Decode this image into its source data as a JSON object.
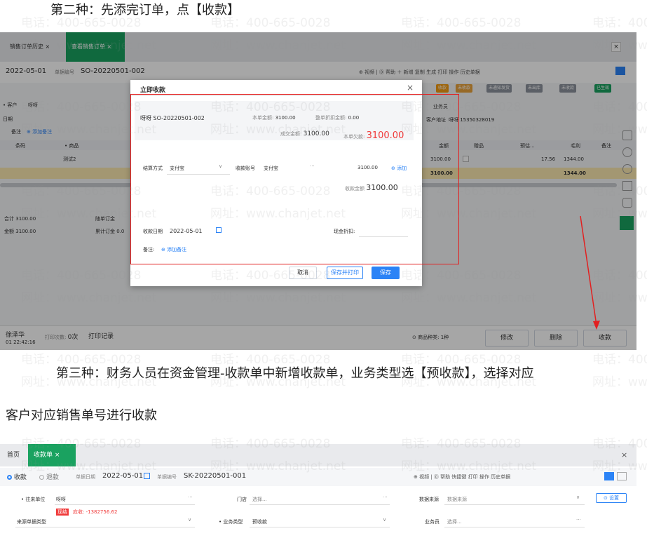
{
  "headings": {
    "h2": "第二种：先添完订单，点【收款】",
    "h3a": "第三种：财务人员在资金管理-收款单中新增收款单，业务类型选【预收款】，选择对应",
    "h3b": "客户对应销售单号进行收款"
  },
  "watermark": {
    "phone": "电话：400-665-0028",
    "site": "网址：www.chanjet.net"
  },
  "shot1": {
    "tabs": {
      "history": "销售订单历史 ×",
      "view": "查看销售订单 ×"
    },
    "date": "2022-05-01",
    "doc_no_label": "单据编号",
    "doc_no": "SO-20220501-002",
    "toolbar": [
      "⊕ 视频",
      "⓪ 帮助",
      "＋ 新增",
      "复制",
      "生成",
      "打印",
      "操作",
      "历史单据"
    ],
    "customer_label": "• 客户",
    "customer": "呀呀",
    "date2_label": "日期",
    "remark_label": "备注",
    "add_remark": "添加备注",
    "col_barcode": "条码",
    "col_product": "• 商品",
    "product": "测试2",
    "right_cols": [
      "金额",
      "赠品",
      "预估...",
      "毛利",
      "备注"
    ],
    "right_row": [
      "3100.00",
      "",
      "17.56",
      "1344.00"
    ],
    "total_row": [
      "3100.00",
      "1344.00"
    ],
    "status_pills": [
      "收款",
      "未收款",
      "未通知发货",
      "未出库",
      "未收款",
      "已生效"
    ],
    "salesman_label": "业务员",
    "address_label": "客户地址",
    "address": "呀呀 15350328019",
    "sum_label": "合计",
    "sum": "3100.00",
    "amount_label": "金额",
    "amount": "3100.00",
    "deposit_label": "随单订金",
    "deposit_cum_label": "累计订金",
    "deposit_cum": "0.0",
    "user": "徐泽华",
    "datetime": "01 22:42:16",
    "print_count_label": "打印次数:",
    "print_count": "0次",
    "print_record": "打印记录",
    "product_kinds_label": "商品种类:",
    "product_kinds": "1种",
    "modify": "修改",
    "delete": "删除",
    "collect": "收款"
  },
  "dialog": {
    "title": "立即收款",
    "close": "×",
    "order": "呀呀 SO-20220501-002",
    "amount_label": "本单金额:",
    "amount": "3100.00",
    "discount_label": "整单折扣金额:",
    "discount": "0.00",
    "deal_label": "成交金额:",
    "deal": "3100.00",
    "owed_label": "本单欠款:",
    "owed": "3100.00",
    "settle_label": "结算方式",
    "settle": "支付宝",
    "account_label": "收款账号",
    "account": "支付宝",
    "pay_amount": "3100.00",
    "add": "添加",
    "collect_label": "收款金额",
    "collect": "3100.00",
    "date_label": "收款日期",
    "date": "2022-05-01",
    "cash_discount_label": "现金折扣:",
    "remark_label": "备注:",
    "add_remark": "添加备注",
    "cancel": "取消",
    "save_print": "保存并打印",
    "save": "保存"
  },
  "shot2": {
    "tab_home": "首页",
    "tab_receipt": "收款单 ×",
    "close": "×",
    "radio_receive": "收款",
    "radio_refund": "退款",
    "date_label": "单据日期",
    "date": "2022-05-01",
    "doc_no_label": "单据编号",
    "doc_no": "SK-20220501-001",
    "toolbar": [
      "⊕ 视频",
      "⓪ 帮助",
      "快捷键",
      "打印",
      "操作",
      "历史单据"
    ],
    "partner_label": "• 往来单位",
    "partner": "呀呀",
    "receivable_tag": "现结",
    "receivable": "应收: -1382756.62",
    "store_label": "门店",
    "store_placeholder": "选择...",
    "source_label": "数据来源",
    "source_placeholder": "数据来源",
    "settings": "⊙ 设置",
    "source_type_label": "来源单据类型",
    "biz_type_label": "• 业务类型",
    "biz_type": "预收款",
    "salesman_label": "业务员",
    "salesman_placeholder": "选择..."
  },
  "colors": {
    "accent": "#2b83f6",
    "green": "#1aa260",
    "red_box": "#e22020",
    "red_text": "#f03a3a",
    "orange": "#f39c12"
  }
}
